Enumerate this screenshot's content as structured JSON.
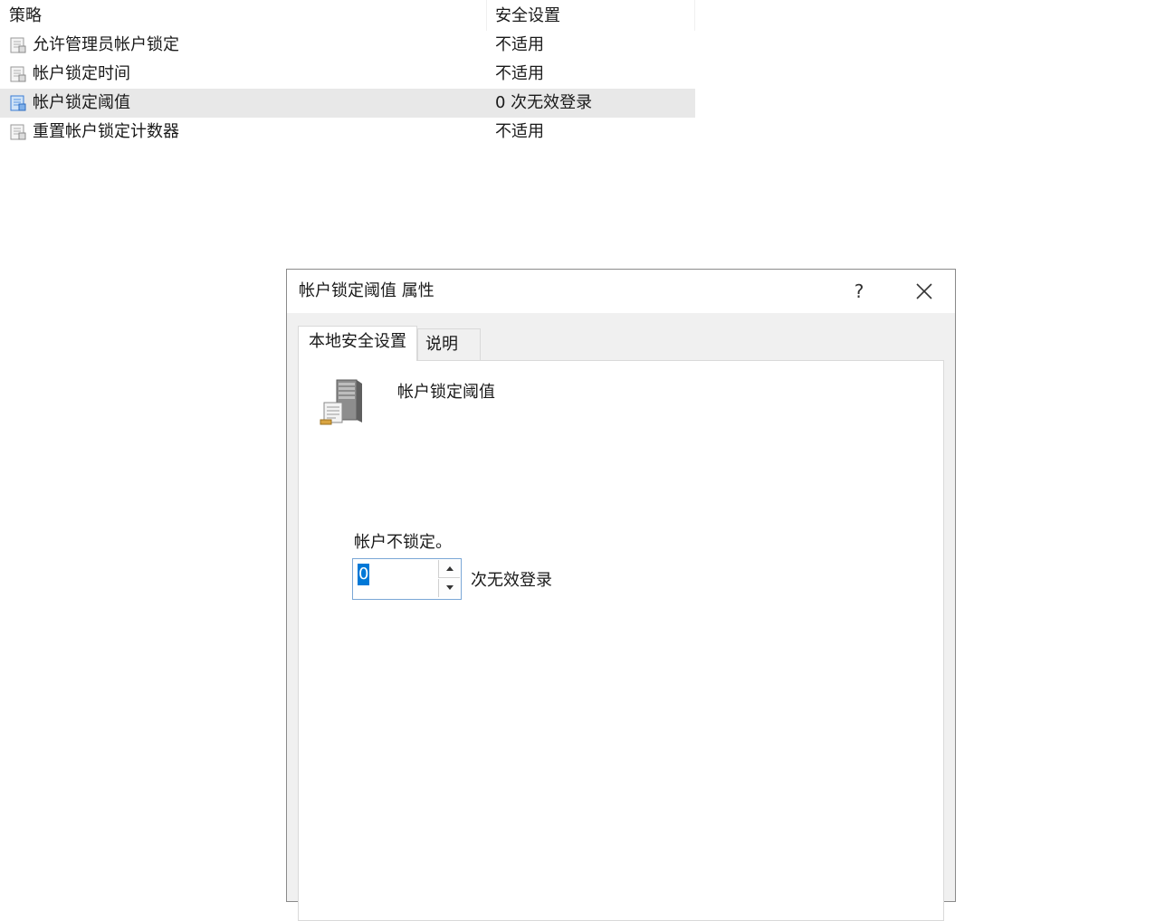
{
  "policy_list": {
    "columns": {
      "policy": "策略",
      "setting": "安全设置"
    },
    "rows": [
      {
        "name": "允许管理员帐户锁定",
        "value": "不适用",
        "icon": "policy-document-icon"
      },
      {
        "name": "帐户锁定时间",
        "value": "不适用",
        "icon": "policy-document-icon"
      },
      {
        "name": "帐户锁定阈值",
        "value": "0 次无效登录",
        "icon": "policy-document-selected-icon",
        "selected": true
      },
      {
        "name": "重置帐户锁定计数器",
        "value": "不适用",
        "icon": "policy-document-icon"
      }
    ]
  },
  "dialog": {
    "title": "帐户锁定阈值 属性",
    "help_label": "?",
    "tabs": [
      {
        "label": "本地安全设置",
        "active": true
      },
      {
        "label": "说明",
        "active": false
      }
    ],
    "policy_title": "帐户锁定阈值",
    "state_text": "帐户不锁定。",
    "threshold_value": "0",
    "unit_label": "次无效登录"
  },
  "colors": {
    "selection_blue": "#0078d7",
    "selected_row": "#e8e8e8",
    "dialog_bg": "#f0f0f0"
  }
}
